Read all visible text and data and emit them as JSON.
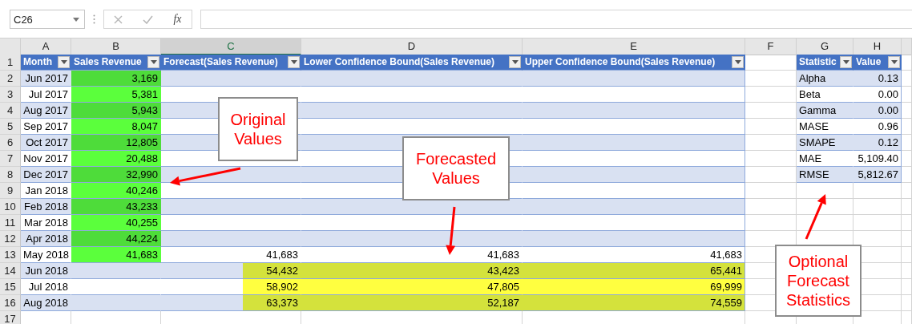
{
  "name_box": {
    "value": "C26"
  },
  "formula_bar": {
    "function_label": "fx"
  },
  "columns": [
    {
      "letter": "A",
      "selected": false
    },
    {
      "letter": "B",
      "selected": false
    },
    {
      "letter": "C",
      "selected": true
    },
    {
      "letter": "D",
      "selected": false
    },
    {
      "letter": "E",
      "selected": false
    },
    {
      "letter": "F",
      "selected": false
    },
    {
      "letter": "G",
      "selected": false
    },
    {
      "letter": "H",
      "selected": false
    }
  ],
  "row_numbers": [
    "1",
    "2",
    "3",
    "4",
    "5",
    "6",
    "7",
    "8",
    "9",
    "10",
    "11",
    "12",
    "13",
    "14",
    "15",
    "16",
    "17"
  ],
  "forecast_table": {
    "headers": [
      "Month",
      "Sales Revenue",
      "Forecast(Sales Revenue)",
      "Lower Confidence Bound(Sales Revenue)",
      "Upper Confidence Bound(Sales Revenue)"
    ],
    "rows": [
      {
        "kind": "actual",
        "month": "Jun 2017",
        "sales": "3,169"
      },
      {
        "kind": "actual",
        "month": "Jul 2017",
        "sales": "5,381"
      },
      {
        "kind": "actual",
        "month": "Aug 2017",
        "sales": "5,943"
      },
      {
        "kind": "actual",
        "month": "Sep 2017",
        "sales": "8,047"
      },
      {
        "kind": "actual",
        "month": "Oct 2017",
        "sales": "12,805"
      },
      {
        "kind": "actual",
        "month": "Nov 2017",
        "sales": "20,488"
      },
      {
        "kind": "actual",
        "month": "Dec 2017",
        "sales": "32,990"
      },
      {
        "kind": "actual",
        "month": "Jan 2018",
        "sales": "40,246"
      },
      {
        "kind": "actual",
        "month": "Feb 2018",
        "sales": "43,233"
      },
      {
        "kind": "actual",
        "month": "Mar 2018",
        "sales": "40,255"
      },
      {
        "kind": "actual",
        "month": "Apr 2018",
        "sales": "44,224"
      },
      {
        "kind": "actual",
        "month": "May 2018",
        "sales": "41,683",
        "forecast": "41,683",
        "lower": "41,683",
        "upper": "41,683"
      },
      {
        "kind": "forecast",
        "month": "Jun 2018",
        "forecast": "54,432",
        "lower": "43,423",
        "upper": "65,441"
      },
      {
        "kind": "forecast",
        "month": "Jul 2018",
        "forecast": "58,902",
        "lower": "47,805",
        "upper": "69,999"
      },
      {
        "kind": "forecast",
        "month": "Aug 2018",
        "forecast": "63,373",
        "lower": "52,187",
        "upper": "74,559"
      }
    ]
  },
  "stats_table": {
    "headers": [
      "Statistic",
      "Value"
    ],
    "rows": [
      {
        "name": "Alpha",
        "value": "0.13"
      },
      {
        "name": "Beta",
        "value": "0.00"
      },
      {
        "name": "Gamma",
        "value": "0.00"
      },
      {
        "name": "MASE",
        "value": "0.96"
      },
      {
        "name": "SMAPE",
        "value": "0.12"
      },
      {
        "name": "MAE",
        "value": "5,109.40"
      },
      {
        "name": "RMSE",
        "value": "5,812.67"
      }
    ]
  },
  "callouts": [
    {
      "text": "Original Values"
    },
    {
      "text": "Forecasted Values"
    },
    {
      "text": "Optional Forecast Statistics"
    }
  ]
}
